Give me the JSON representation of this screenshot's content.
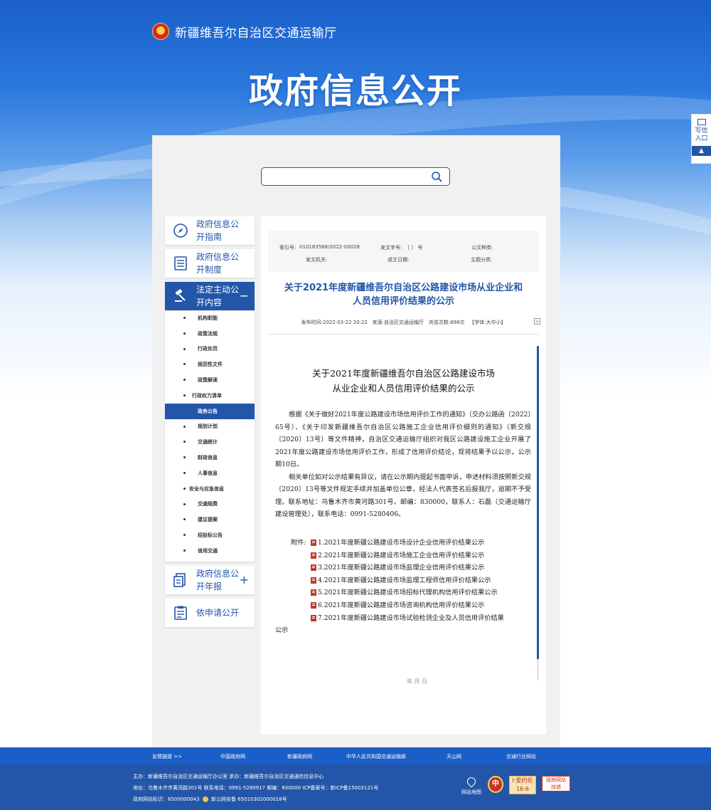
{
  "header": {
    "site_name": "新疆维吾尔自治区交通运输厅",
    "page_heading": "政府信息公开"
  },
  "side_widget": {
    "label_1": "写信",
    "label_2": "入口",
    "arrow": "▲"
  },
  "search": {
    "placeholder": "",
    "value": ""
  },
  "sidebar": {
    "blocks": [
      {
        "label": "政府信息公开指南",
        "sign": ""
      },
      {
        "label": "政府信息公开制度",
        "sign": ""
      },
      {
        "label": "法定主动公开内容",
        "sign": "−"
      },
      {
        "label": "政府信息公开年报",
        "sign": "+"
      },
      {
        "label": "依申请公开",
        "sign": ""
      }
    ],
    "sub_items": [
      "机构职能",
      "政策法规",
      "行政处罚",
      "规范性文件",
      "政策解读",
      "行政权力清单",
      "政务公告",
      "规划计划",
      "交通统计",
      "财政信息",
      "人事信息",
      "安全与应急信息",
      "交通规费",
      "建议提案",
      "招投标公告",
      "信用交通"
    ],
    "active_sub": "政务公告"
  },
  "meta": {
    "index_no_label": "索引号:",
    "index_no": "010183568/2022-00028",
    "doc_no_label": "发文字号:",
    "doc_no": "〔 〕 号",
    "doc_type_label": "公文种类:",
    "doc_type": "",
    "issuer_label": "发文机关:",
    "issuer": "",
    "date_label": "成文日期:",
    "date": "",
    "topic_label": "主题分类:",
    "topic": ""
  },
  "article": {
    "title_line_1": "关于2021年度新疆维吾尔自治区公路建设市场从业企业和",
    "title_line_2": "人员信用评价结果的公示",
    "publish_time_label": "发布时间:",
    "publish_time": "2022-03-22 20:22",
    "source_label": "来源:",
    "source": "自治区交通运输厅",
    "views_label": "浏览次数:",
    "views": "898次",
    "font_label": "【字体:大中小】",
    "expand": "+"
  },
  "document": {
    "title_line_1": "关于2021年度新疆维吾尔自治区公路建设市场",
    "title_line_2": "从业企业和人员信用评价结果的公示",
    "paragraph_1": "根据《关于做好2021年度公路建设市场信用评价工作的通知》（交办公路函〔2022〕65号）、《关于印发新疆维吾尔自治区公路施工企业信用评价细则的通知》（新交规〔2020〕13号）等文件精神，自治区交通运输厅组织对我区公路建设施工企业开展了2021年度公路建设市场信用评价工作，形成了信用评价结论，现将结果予以公示，公示期10日。",
    "paragraph_2": "相关单位如对公示结果有异议，请在公示期内提起书面申诉，申述材料须按照新交规〔2020〕13号等文件规定手续并加盖单位公章，经法人代表签名后报我厅，逾期不予受理。联系地址：乌鲁木齐市黄河路301号。邮编：830000，联系人：石磊（交通运输厅建设管理处），联系电话：0991-5280406。",
    "attachments_label": "附件:",
    "attachments": [
      "1.2021年度新疆公路建设市场设计企业信用评价结果公示",
      "2.2021年度新疆公路建设市场施工企业信用评价结果公示",
      "3.2021年度新疆公路建设市场监理企业信用评价结果公示",
      "4.2021年度新疆公路建设市场监理工程师信用评价结果公示",
      "5.2021年度新疆公路建设市场招标代理机构信用评价结果公示",
      "6.2021年度新疆公路建设市场咨询机构信用评价结果公示",
      "7.2021年度新疆公路建设市场试验检测企业及人员信用评价结果"
    ],
    "attachment_7_tail": "公示",
    "faint_text": "年 月 日"
  },
  "links_bar": {
    "label": "友情链接 >>",
    "links": [
      "中国政府网",
      "新疆政府网",
      "中华人民共和国交通运输部",
      "天山网",
      "交通行业网站"
    ]
  },
  "footer": {
    "line_1": "主办：新疆维吾尔自治区交通运输厅办公室  承办：新疆维吾尔自治区交通通信信息中心",
    "line_2": "地址：乌鲁木齐市黄河路301号  联系电话：0991-5280917  邮编：830000  ICP备案号：新ICP备15003121号",
    "line_3a": "政府网站标识：6500000043",
    "line_3b": "新公网安备 65010302000018号",
    "map_label": "网站地图",
    "logo1": "中",
    "logo2_top": "I·爱约伦",
    "logo2_bottom": "16·6",
    "logo3_top": "政府网站",
    "logo3_bottom": "找错"
  },
  "colors": {
    "primary": "#2356a8",
    "banner": "#1a5fc8",
    "panel": "#f1f1f1"
  }
}
